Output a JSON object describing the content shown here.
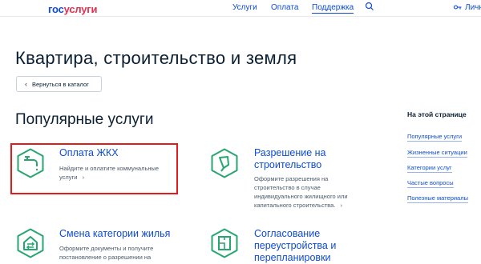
{
  "header": {
    "logo_part1": "гос",
    "logo_part2": "услуги",
    "nav": [
      "Услуги",
      "Оплата",
      "Поддержка"
    ],
    "account_label": "Личн"
  },
  "page": {
    "title": "Квартира, строительство и земля",
    "back_button": "Вернуться в каталог"
  },
  "popular": {
    "title": "Популярные услуги",
    "cards": [
      {
        "title": "Оплата ЖКХ",
        "desc_lines": [
          "Найдите и оплатите коммунальные",
          "услуги"
        ],
        "icon": "faucet-icon"
      },
      {
        "title_lines": [
          "Разрешение на",
          "строительство"
        ],
        "desc_lines": [
          "Оформите разрешения на",
          "строительство в случае",
          "индивидуального жилищного или",
          "капитального строительства."
        ],
        "icon": "trowel-icon"
      },
      {
        "title": "Смена категории жилья",
        "desc_lines": [
          "Оформите документы и получите",
          "постановление о разрешении на"
        ],
        "icon": "house-swap-icon"
      },
      {
        "title_lines": [
          "Согласование",
          "переустройства и",
          "перепланировки"
        ],
        "icon": "floorplan-icon"
      }
    ]
  },
  "sidebar": {
    "title": "На этой странице",
    "links": [
      "Популярные услуги",
      "Жизненные ситуации",
      "Категории услуг",
      "Частые вопросы",
      "Полезные материалы"
    ]
  },
  "colors": {
    "link": "#0d4cd3",
    "icon_green": "#28a66f",
    "highlight_border": "#e31b1b",
    "logo_red": "#e62e4f"
  }
}
